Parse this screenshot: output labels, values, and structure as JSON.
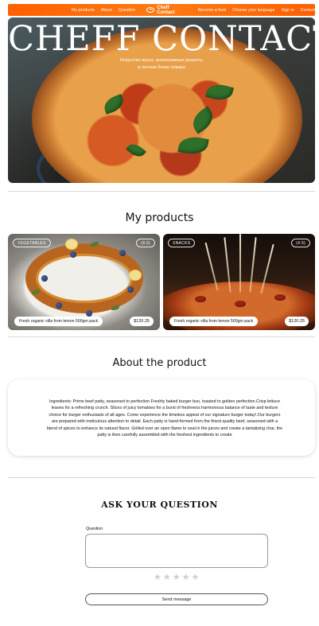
{
  "nav": {
    "links_left": [
      "My products",
      "About",
      "Question"
    ],
    "brand": "Cheff Contact",
    "links_right": [
      "Become a host",
      "Choose your language",
      "Sign in",
      "Contact"
    ]
  },
  "hero": {
    "title": "CHEFF CONTACT",
    "subtitle_line1": "Искусство вкуса: эксклюзивные рецепты",
    "subtitle_line2": "в личном блоке повара"
  },
  "products": {
    "title": "My products",
    "cards": [
      {
        "category": "VEGETABLES",
        "rating": "(4.5)",
        "name": "Fresh organic villa from lemon 500gm pack",
        "price": "$120.25"
      },
      {
        "category": "SNACKS",
        "rating": "(4.5)",
        "name": "Fresh organic villa from lemon 500gm pack",
        "price": "$120.25"
      }
    ]
  },
  "about": {
    "title": "About the product",
    "text": "Ingredients: Prime beef patty, seasoned to perfection  Freshly baked burger bun, toasted to golden perfection.Crisp lettuce leaves for a refreshing crunch. Slices of juicy tomatoes for a burst of freshness harmonious balance of taste and texture choice for burger enthusiasts of all ages. Come experience the timeless appeal of our signature burger today!.Our burgers are prepared with meticulous attention to detail. Each patty is hand-formed from the finest quality beef, seasoned with a blend of spices to enhance its natural flavor. Grilled over an open flame to seal in the juices and create a tantalizing char, the patty is then carefully assembled with the freshest ingredients to create"
  },
  "question": {
    "title": "ASK YOUR QUESTION",
    "label": "Question",
    "stars": [
      "★",
      "★",
      "★",
      "★",
      "★"
    ],
    "rating": 0,
    "submit_label": "Send message"
  },
  "colors": {
    "accent": "#ff6a00",
    "star_empty": "#cfcfcf"
  }
}
